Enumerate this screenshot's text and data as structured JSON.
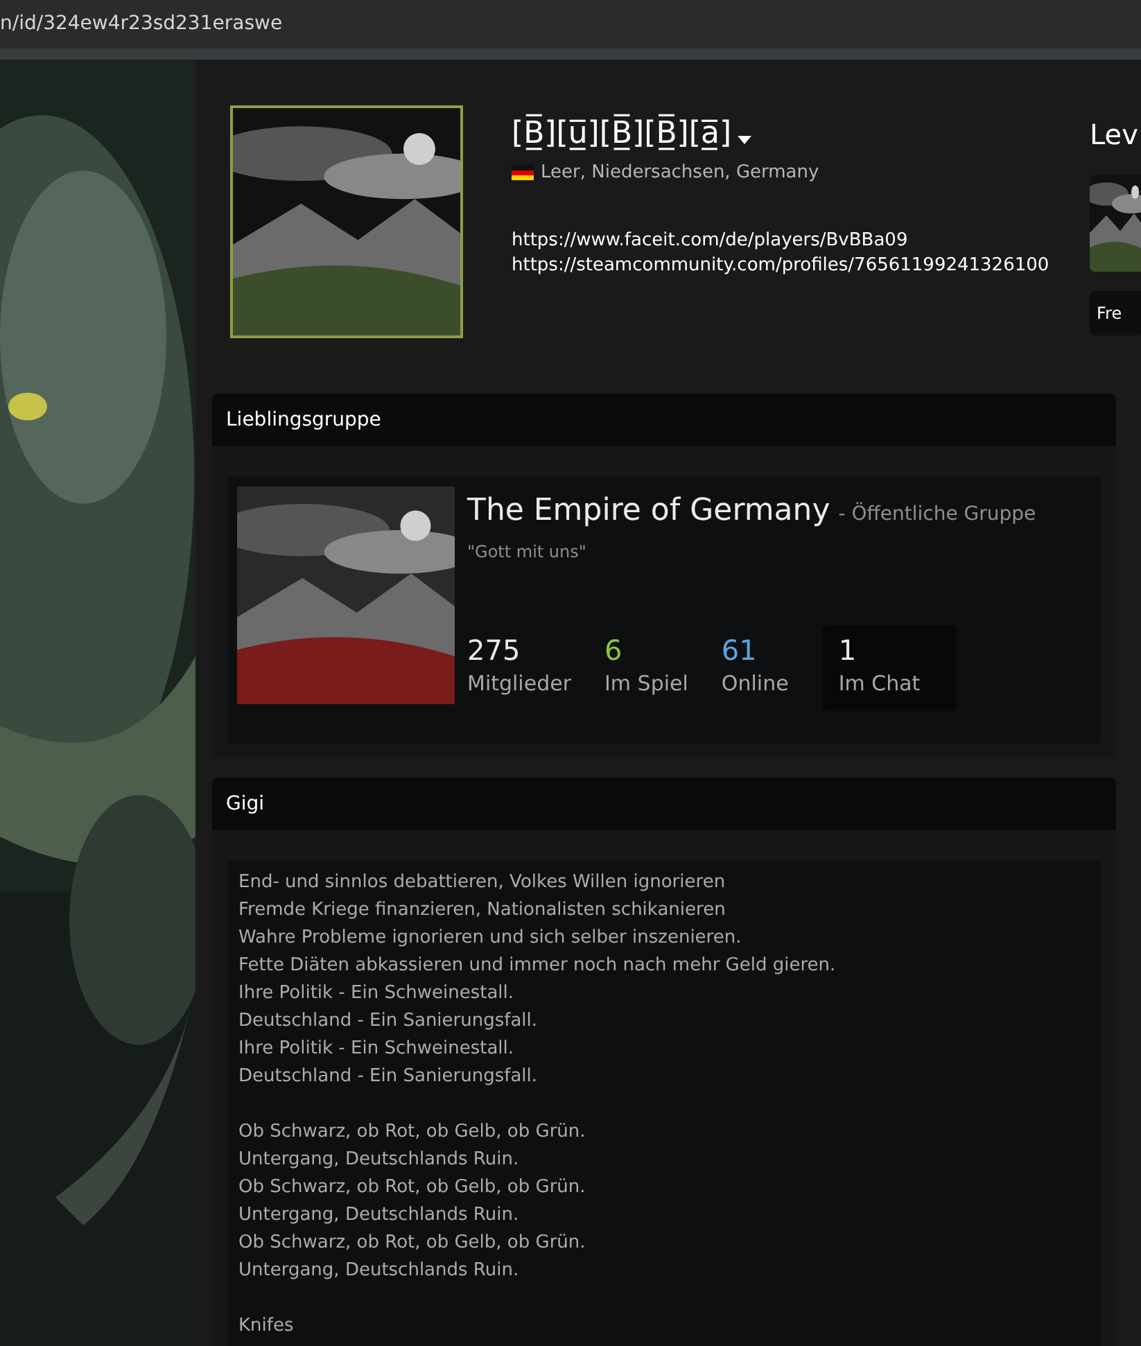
{
  "address_bar": {
    "url": "n/id/324ew4r23sd231eraswe"
  },
  "profile": {
    "name": "[B̲̅][u̲̅][B̲̅][B̲̅][a̲̅]",
    "location": "Leer, Niedersachsen, Germany",
    "links": [
      "https://www.faceit.com/de/players/BvBBa09",
      "https://steamcommunity.com/profiles/76561199241326100"
    ]
  },
  "right_column": {
    "level_heading": "Lev",
    "button": "Fre"
  },
  "favorite_group": {
    "heading": "Lieblingsgruppe",
    "name": "The Empire of Germany",
    "type": "- Öffentliche Gruppe",
    "motto": "\"Gott mit uns\"",
    "stats": [
      {
        "value": "275",
        "label": "Mitglieder",
        "kind": "members"
      },
      {
        "value": "6",
        "label": "Im Spiel",
        "kind": "ingame"
      },
      {
        "value": "61",
        "label": "Online",
        "kind": "online"
      },
      {
        "value": "1",
        "label": "Im Chat",
        "kind": "chat"
      }
    ]
  },
  "info_box": {
    "heading": "Gigi",
    "stanzas": [
      [
        "End- und sinnlos debattieren, Volkes Willen ignorieren",
        "Fremde Kriege finanzieren, Nationalisten schikanieren",
        "Wahre Probleme ignorieren und sich selber inszenieren.",
        "Fette Diäten abkassieren und immer noch nach mehr Geld gieren.",
        "Ihre Politik - Ein Schweinestall.",
        "Deutschland - Ein Sanierungsfall.",
        "Ihre Politik - Ein Schweinestall.",
        "Deutschland - Ein Sanierungsfall."
      ],
      [
        "Ob Schwarz, ob Rot, ob Gelb, ob Grün.",
        "Untergang, Deutschlands Ruin.",
        "Ob Schwarz, ob Rot, ob Gelb, ob Grün.",
        "Untergang, Deutschlands Ruin.",
        "Ob Schwarz, ob Rot, ob Gelb, ob Grün.",
        "Untergang, Deutschlands Ruin."
      ],
      [
        "Knifes"
      ]
    ]
  }
}
